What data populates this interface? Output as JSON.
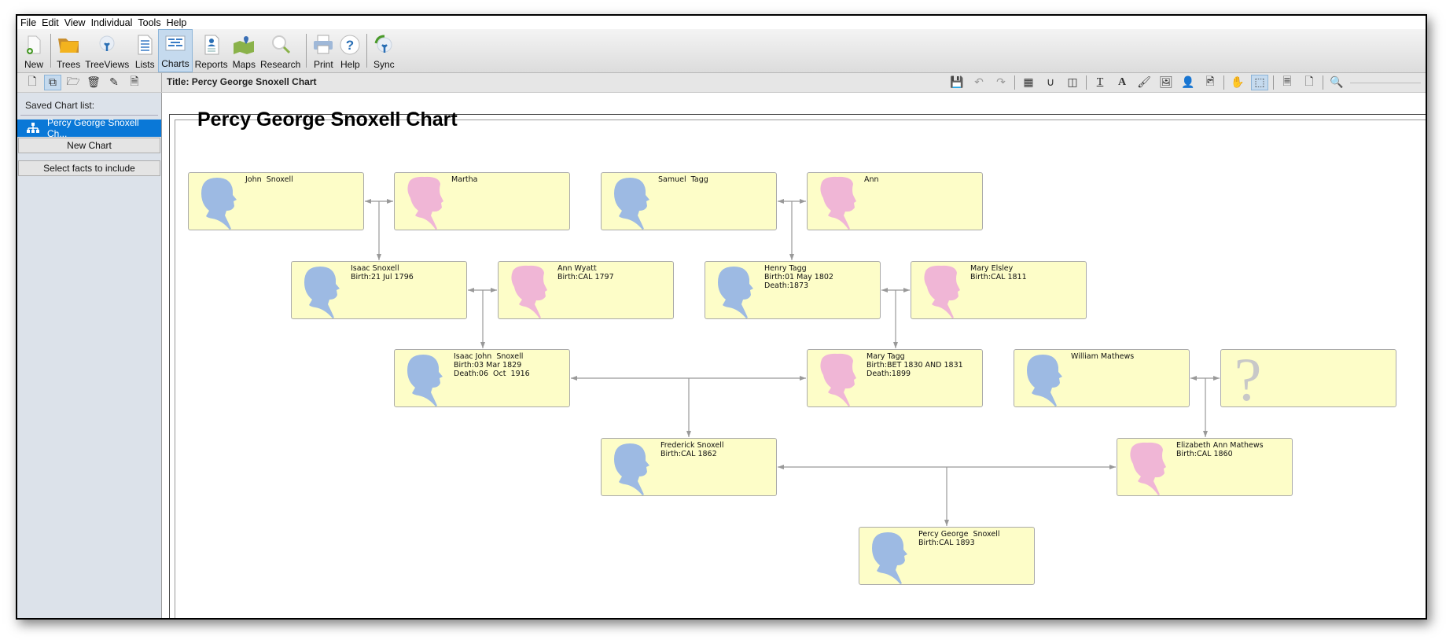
{
  "menu": [
    "File",
    "Edit",
    "View",
    "Individual",
    "Tools",
    "Help"
  ],
  "toolbar": {
    "buttons": [
      {
        "label": "New",
        "icon": "new-document-icon"
      },
      {
        "label": "Trees",
        "icon": "folder-icon"
      },
      {
        "label": "TreeViews",
        "icon": "tree-cloud-icon"
      },
      {
        "label": "Lists",
        "icon": "list-icon"
      },
      {
        "label": "Charts",
        "icon": "chart-icon",
        "active": true
      },
      {
        "label": "Reports",
        "icon": "report-icon"
      },
      {
        "label": "Maps",
        "icon": "map-icon"
      },
      {
        "label": "Research",
        "icon": "magnifier-icon"
      },
      {
        "label": "Print",
        "icon": "printer-icon"
      },
      {
        "label": "Help",
        "icon": "help-icon"
      },
      {
        "label": "Sync",
        "icon": "sync-icon"
      }
    ]
  },
  "subtoolbar": {
    "title": "Title: Percy George Snoxell Chart",
    "left_icons": [
      "new-chart-icon",
      "copy-chart-icon",
      "open-chart-icon",
      "delete-chart-icon",
      "rename-chart-icon",
      "pdf-export-icon"
    ],
    "right_icons": [
      "save-icon",
      "undo-icon",
      "redo-icon",
      "grid-icon",
      "magnet-icon",
      "split-view-icon",
      "text-icon",
      "font-icon",
      "brush-icon",
      "image-icon",
      "person-icon",
      "picture-document-icon",
      "hand-pan-icon",
      "select-rectangle-icon",
      "page-layout-icon",
      "page-icon",
      "zoom-out-icon"
    ]
  },
  "sidebar": {
    "label": "Saved Chart list:",
    "selected_item": "Percy George Snoxell Ch...",
    "new_chart": "New Chart",
    "select_facts": "Select facts to include"
  },
  "chart": {
    "title": "Percy George Snoxell Chart",
    "colors": {
      "male": "#9dbae3",
      "female": "#f0b6d6",
      "unknown": "#c8c8c8",
      "box": "#fdfdc8",
      "line": "#999999"
    },
    "people": [
      {
        "id": "john",
        "name": "John  Snoxell",
        "facts": [],
        "sex": "male"
      },
      {
        "id": "martha",
        "name": "Martha",
        "facts": [],
        "sex": "female"
      },
      {
        "id": "samuel",
        "name": "Samuel  Tagg",
        "facts": [],
        "sex": "male"
      },
      {
        "id": "ann",
        "name": "Ann",
        "facts": [],
        "sex": "female"
      },
      {
        "id": "isaac",
        "name": "Isaac Snoxell",
        "facts": [
          "Birth:21 Jul 1796"
        ],
        "sex": "male"
      },
      {
        "id": "annwyatt",
        "name": "Ann Wyatt",
        "facts": [
          "Birth:CAL 1797"
        ],
        "sex": "female"
      },
      {
        "id": "henry",
        "name": "Henry Tagg",
        "facts": [
          "Birth:01 May 1802",
          "Death:1873"
        ],
        "sex": "male"
      },
      {
        "id": "maryelsley",
        "name": "Mary Elsley",
        "facts": [
          "Birth:CAL 1811"
        ],
        "sex": "female"
      },
      {
        "id": "isaacjohn",
        "name": "Isaac John  Snoxell",
        "facts": [
          "Birth:03 Mar 1829",
          "Death:06  Oct  1916"
        ],
        "sex": "male"
      },
      {
        "id": "marytagg",
        "name": "Mary Tagg",
        "facts": [
          "Birth:BET 1830 AND 1831",
          "Death:1899"
        ],
        "sex": "female"
      },
      {
        "id": "william",
        "name": "William Mathews",
        "facts": [],
        "sex": "male"
      },
      {
        "id": "unknown",
        "name": "",
        "facts": [],
        "sex": "unknown"
      },
      {
        "id": "frederick",
        "name": "Frederick Snoxell",
        "facts": [
          "Birth:CAL 1862"
        ],
        "sex": "male"
      },
      {
        "id": "elizabeth",
        "name": "Elizabeth Ann Mathews",
        "facts": [
          "Birth:CAL 1860"
        ],
        "sex": "female"
      },
      {
        "id": "percy",
        "name": "Percy George  Snoxell",
        "facts": [
          "Birth:CAL 1893"
        ],
        "sex": "male"
      }
    ],
    "families": [
      {
        "husband": "john",
        "wife": "martha",
        "child": "isaac"
      },
      {
        "husband": "samuel",
        "wife": "ann",
        "child": "henry"
      },
      {
        "husband": "isaac",
        "wife": "annwyatt",
        "child": "isaacjohn"
      },
      {
        "husband": "henry",
        "wife": "maryelsley",
        "child": "marytagg"
      },
      {
        "husband": "isaacjohn",
        "wife": "marytagg",
        "child": "frederick"
      },
      {
        "husband": "william",
        "wife": "unknown",
        "child": "elizabeth"
      },
      {
        "husband": "frederick",
        "wife": "elizabeth",
        "child": "percy"
      }
    ]
  }
}
